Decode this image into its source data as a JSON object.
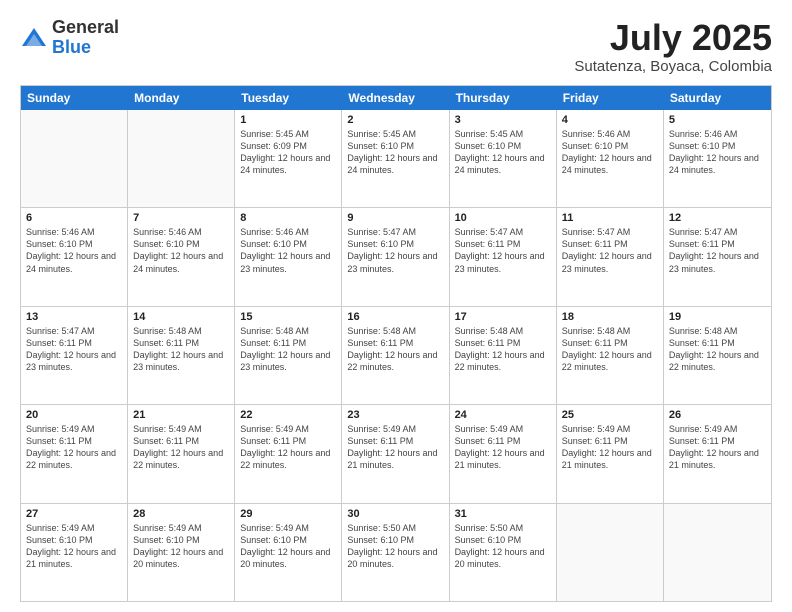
{
  "header": {
    "logo_general": "General",
    "logo_blue": "Blue",
    "title": "July 2025",
    "subtitle": "Sutatenza, Boyaca, Colombia"
  },
  "weekdays": [
    "Sunday",
    "Monday",
    "Tuesday",
    "Wednesday",
    "Thursday",
    "Friday",
    "Saturday"
  ],
  "weeks": [
    [
      {
        "day": "",
        "info": "",
        "empty": true
      },
      {
        "day": "",
        "info": "",
        "empty": true
      },
      {
        "day": "1",
        "info": "Sunrise: 5:45 AM\nSunset: 6:09 PM\nDaylight: 12 hours and 24 minutes."
      },
      {
        "day": "2",
        "info": "Sunrise: 5:45 AM\nSunset: 6:10 PM\nDaylight: 12 hours and 24 minutes."
      },
      {
        "day": "3",
        "info": "Sunrise: 5:45 AM\nSunset: 6:10 PM\nDaylight: 12 hours and 24 minutes."
      },
      {
        "day": "4",
        "info": "Sunrise: 5:46 AM\nSunset: 6:10 PM\nDaylight: 12 hours and 24 minutes."
      },
      {
        "day": "5",
        "info": "Sunrise: 5:46 AM\nSunset: 6:10 PM\nDaylight: 12 hours and 24 minutes."
      }
    ],
    [
      {
        "day": "6",
        "info": "Sunrise: 5:46 AM\nSunset: 6:10 PM\nDaylight: 12 hours and 24 minutes."
      },
      {
        "day": "7",
        "info": "Sunrise: 5:46 AM\nSunset: 6:10 PM\nDaylight: 12 hours and 24 minutes."
      },
      {
        "day": "8",
        "info": "Sunrise: 5:46 AM\nSunset: 6:10 PM\nDaylight: 12 hours and 23 minutes."
      },
      {
        "day": "9",
        "info": "Sunrise: 5:47 AM\nSunset: 6:10 PM\nDaylight: 12 hours and 23 minutes."
      },
      {
        "day": "10",
        "info": "Sunrise: 5:47 AM\nSunset: 6:11 PM\nDaylight: 12 hours and 23 minutes."
      },
      {
        "day": "11",
        "info": "Sunrise: 5:47 AM\nSunset: 6:11 PM\nDaylight: 12 hours and 23 minutes."
      },
      {
        "day": "12",
        "info": "Sunrise: 5:47 AM\nSunset: 6:11 PM\nDaylight: 12 hours and 23 minutes."
      }
    ],
    [
      {
        "day": "13",
        "info": "Sunrise: 5:47 AM\nSunset: 6:11 PM\nDaylight: 12 hours and 23 minutes."
      },
      {
        "day": "14",
        "info": "Sunrise: 5:48 AM\nSunset: 6:11 PM\nDaylight: 12 hours and 23 minutes."
      },
      {
        "day": "15",
        "info": "Sunrise: 5:48 AM\nSunset: 6:11 PM\nDaylight: 12 hours and 23 minutes."
      },
      {
        "day": "16",
        "info": "Sunrise: 5:48 AM\nSunset: 6:11 PM\nDaylight: 12 hours and 22 minutes."
      },
      {
        "day": "17",
        "info": "Sunrise: 5:48 AM\nSunset: 6:11 PM\nDaylight: 12 hours and 22 minutes."
      },
      {
        "day": "18",
        "info": "Sunrise: 5:48 AM\nSunset: 6:11 PM\nDaylight: 12 hours and 22 minutes."
      },
      {
        "day": "19",
        "info": "Sunrise: 5:48 AM\nSunset: 6:11 PM\nDaylight: 12 hours and 22 minutes."
      }
    ],
    [
      {
        "day": "20",
        "info": "Sunrise: 5:49 AM\nSunset: 6:11 PM\nDaylight: 12 hours and 22 minutes."
      },
      {
        "day": "21",
        "info": "Sunrise: 5:49 AM\nSunset: 6:11 PM\nDaylight: 12 hours and 22 minutes."
      },
      {
        "day": "22",
        "info": "Sunrise: 5:49 AM\nSunset: 6:11 PM\nDaylight: 12 hours and 22 minutes."
      },
      {
        "day": "23",
        "info": "Sunrise: 5:49 AM\nSunset: 6:11 PM\nDaylight: 12 hours and 21 minutes."
      },
      {
        "day": "24",
        "info": "Sunrise: 5:49 AM\nSunset: 6:11 PM\nDaylight: 12 hours and 21 minutes."
      },
      {
        "day": "25",
        "info": "Sunrise: 5:49 AM\nSunset: 6:11 PM\nDaylight: 12 hours and 21 minutes."
      },
      {
        "day": "26",
        "info": "Sunrise: 5:49 AM\nSunset: 6:11 PM\nDaylight: 12 hours and 21 minutes."
      }
    ],
    [
      {
        "day": "27",
        "info": "Sunrise: 5:49 AM\nSunset: 6:10 PM\nDaylight: 12 hours and 21 minutes."
      },
      {
        "day": "28",
        "info": "Sunrise: 5:49 AM\nSunset: 6:10 PM\nDaylight: 12 hours and 20 minutes."
      },
      {
        "day": "29",
        "info": "Sunrise: 5:49 AM\nSunset: 6:10 PM\nDaylight: 12 hours and 20 minutes."
      },
      {
        "day": "30",
        "info": "Sunrise: 5:50 AM\nSunset: 6:10 PM\nDaylight: 12 hours and 20 minutes."
      },
      {
        "day": "31",
        "info": "Sunrise: 5:50 AM\nSunset: 6:10 PM\nDaylight: 12 hours and 20 minutes."
      },
      {
        "day": "",
        "info": "",
        "empty": true
      },
      {
        "day": "",
        "info": "",
        "empty": true
      }
    ]
  ]
}
